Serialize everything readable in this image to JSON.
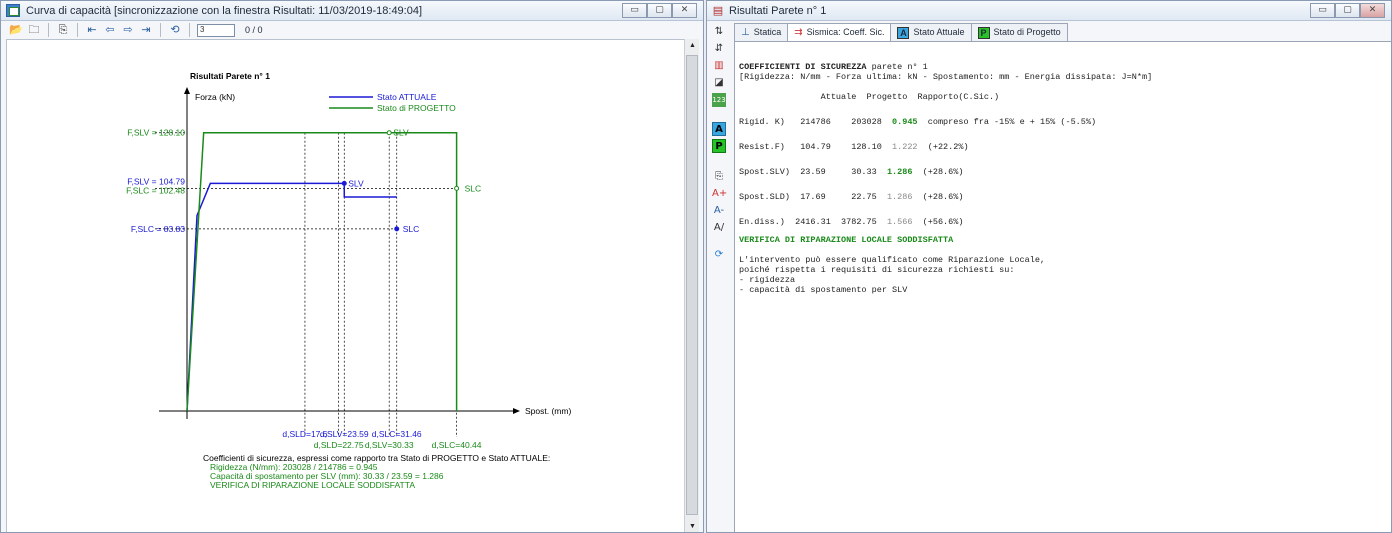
{
  "left_window": {
    "title": "Curva di capacità [sincronizzazione con la finestra Risultati: 11/03/2019-18:49:04]",
    "toolbar": {
      "input_value": "3",
      "counter": "0 / 0"
    },
    "controls": [
      "▭",
      "▢",
      "✕"
    ]
  },
  "chart_data": {
    "type": "line",
    "title": "Risultati Parete n° 1",
    "ylabel": "Forza (kN)",
    "xlabel": "Spost. (mm)",
    "xlim": [
      0,
      48
    ],
    "ylim": [
      0,
      145
    ],
    "legend": {
      "placement": "top-right",
      "entries": [
        "Stato ATTUALE",
        "Stato di PROGETTO"
      ]
    },
    "colors": {
      "attuale": "#1a1ad6",
      "progetto": "#1a8a1a"
    },
    "series": [
      {
        "name": "Stato ATTUALE",
        "color": "#1a1ad6",
        "x": [
          0,
          1.5,
          3.5,
          23.59,
          23.59,
          31.46
        ],
        "y": [
          0,
          90,
          104.79,
          104.79,
          98.5,
          98.5
        ]
      },
      {
        "name": "Stato di PROGETTO",
        "color": "#1a8a1a",
        "x": [
          0,
          2.5,
          40.44,
          40.44
        ],
        "y": [
          0,
          128.1,
          128.1,
          0
        ]
      }
    ],
    "points": [
      {
        "label": "SLV",
        "x": 30.33,
        "y": 128.1,
        "color": "#1a8a1a",
        "text_dx": 4
      },
      {
        "label": "SLC",
        "x": 40.44,
        "y": 102.48,
        "color": "#1a8a1a",
        "text_dx": 8
      },
      {
        "label": "SLV",
        "x": 23.59,
        "y": 104.79,
        "color": "#1a1ad6",
        "text_dx": 4
      },
      {
        "label": "SLC",
        "x": 31.46,
        "y": 83.83,
        "color": "#1a1ad6",
        "text_dx": 6
      }
    ],
    "y_labels": [
      {
        "text": "F,SLV = 128.10",
        "y": 128.1,
        "color": "#1a8a1a",
        "dy": 0
      },
      {
        "text": "F,SLV = 104.79",
        "y": 104.79,
        "color": "#1a1ad6",
        "dy": -2
      },
      {
        "text": "F,SLC = 102.48",
        "y": 102.48,
        "color": "#1a8a1a",
        "dy": 2
      },
      {
        "text": "F,SLC = 83.83",
        "y": 83.83,
        "color": "#1a1ad6",
        "dy": 0
      }
    ],
    "h_guides": [
      {
        "y": 128.1,
        "x_end": 0
      },
      {
        "y": 102.48,
        "x_end": 40.44
      },
      {
        "y": 83.83,
        "x_end": 31.46
      }
    ],
    "v_guides": [
      17.69,
      22.75,
      23.59,
      30.33,
      31.46,
      40.44
    ],
    "x_labels": [
      {
        "text": "d,SLD=17.6",
        "x": 17.69,
        "row": 1,
        "color": "#1a1ad6"
      },
      {
        "text": "d,SLV=23.59",
        "x": 23.59,
        "row": 1,
        "color": "#1a1ad6"
      },
      {
        "text": "d,SLC=31.46",
        "x": 31.46,
        "row": 1,
        "color": "#1a1ad6"
      },
      {
        "text": "d,SLD=22.75",
        "x": 22.75,
        "row": 2,
        "color": "#1a8a1a"
      },
      {
        "text": "d,SLV=30.33",
        "x": 30.33,
        "row": 2,
        "color": "#1a8a1a"
      },
      {
        "text": "d,SLC=40.44",
        "x": 40.44,
        "row": 2,
        "color": "#1a8a1a"
      }
    ],
    "annotations": [
      {
        "text": "Coefficienti di sicurezza, espressi come rapporto tra Stato di PROGETTO e Stato ATTUALE:",
        "color": "#000000"
      },
      {
        "text": "Rigidezza (N/mm): 203028 / 214786 = 0.945",
        "color": "#1a8a1a"
      },
      {
        "text": "Capacità di spostamento per SLV (mm): 30.33 / 23.59 = 1.286",
        "color": "#1a8a1a"
      },
      {
        "text": "VERIFICA DI RIPARAZIONE LOCALE SODDISFATTA",
        "color": "#1a8a1a"
      }
    ]
  },
  "right_window": {
    "title": "Risultati Parete n° 1",
    "controls": [
      "▭",
      "▢",
      "✕"
    ],
    "tabs": [
      {
        "label": "Statica",
        "active": false
      },
      {
        "label": "Sismica: Coeff. Sic.",
        "active": true
      },
      {
        "label": "Stato Attuale",
        "active": false,
        "badge": "A"
      },
      {
        "label": "Stato di Progetto",
        "active": false,
        "badge": "P"
      }
    ],
    "report": {
      "heading_bold": "COEFFICIENTI DI SICUREZZA",
      "heading_rest": " parete n° 1",
      "units": "[Rigidezza: N/mm - Forza ultima: kN - Spostamento: mm - Energia dissipata: J=N*m]",
      "columns": "                Attuale  Progetto  Rapporto(C.Sic.)",
      "rows": [
        {
          "label": "Rigid. K)  ",
          "vals": " 214786    203028  ",
          "ratio": "0.945",
          "note": "  compreso fra -15% e + 15% (-5.5%)",
          "ratio_style": "green bold"
        },
        {
          "label": "Resist.F)  ",
          "vals": " 104.79    128.10  ",
          "ratio": "1.222",
          "note": "  (+22.2%)",
          "ratio_style": "gray"
        },
        {
          "label": "Spost.SLV) ",
          "vals": " 23.59     30.33  ",
          "ratio": "1.286",
          "note": "  (+28.6%)",
          "ratio_style": "green bold"
        },
        {
          "label": "Spost.SLD) ",
          "vals": " 17.69     22.75  ",
          "ratio": "1.286",
          "note": "  (+28.6%)",
          "ratio_style": "gray"
        },
        {
          "label": "En.diss.)  ",
          "vals": "2416.31  3782.75  ",
          "ratio": "1.566",
          "note": "  (+56.6%)",
          "ratio_style": "gray"
        }
      ],
      "verdict": "VERIFICA DI RIPARAZIONE LOCALE SODDISFATTA",
      "paragraph": [
        "L'intervento può essere qualificato come Riparazione Locale,",
        "poiché rispetta i requisiti di sicurezza richiesti su:",
        "- rigidezza",
        "- capacità di spostamento per SLV"
      ]
    }
  }
}
